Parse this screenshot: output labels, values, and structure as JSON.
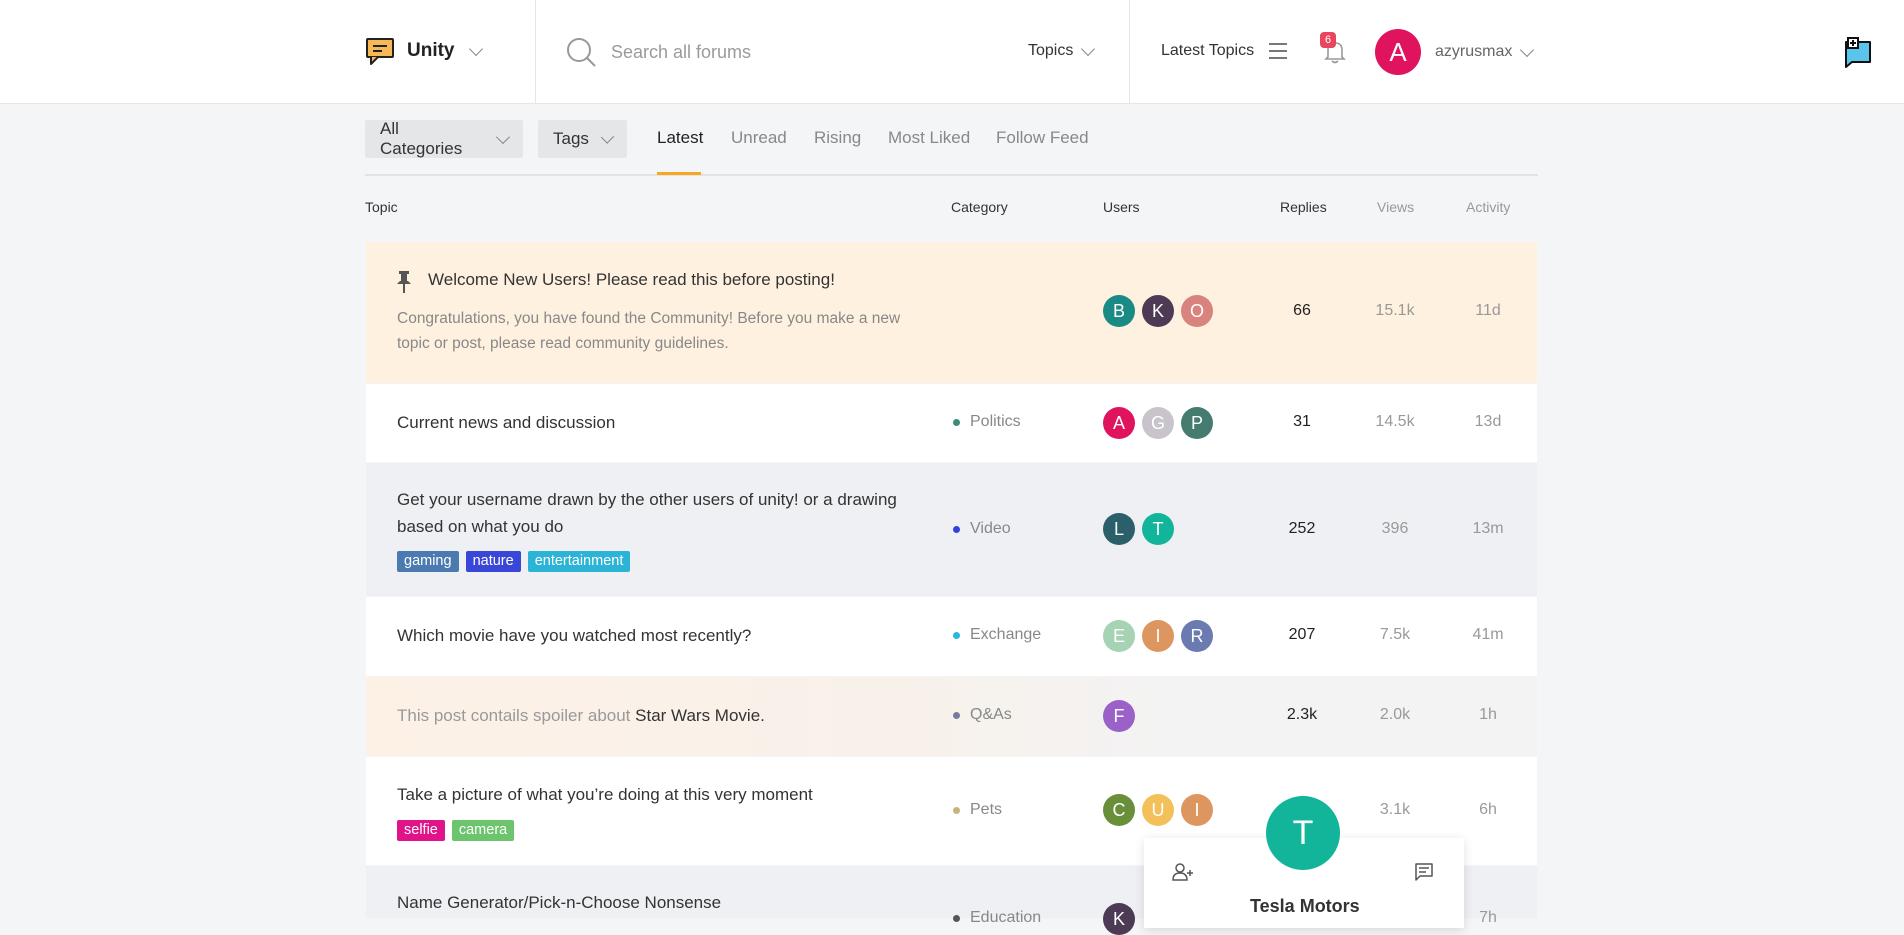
{
  "header": {
    "brand": "Unity",
    "search_placeholder": "Search all forums",
    "topics_label": "Topics",
    "latest_topics_label": "Latest Topics",
    "notification_count": "6",
    "user_initial": "A",
    "username": "azyrusmax"
  },
  "filters": {
    "categories_label": "All Categories",
    "tags_label": "Tags",
    "tabs": [
      "Latest",
      "Unread",
      "Rising",
      "Most Liked",
      "Follow Feed"
    ],
    "active_tab": "Latest"
  },
  "columns": {
    "topic": "Topic",
    "category": "Category",
    "users": "Users",
    "replies": "Replies",
    "views": "Views",
    "activity": "Activity"
  },
  "topics": [
    {
      "title": "Welcome New Users! Please read this before posting!",
      "excerpt_line1": "Congratulations, you have found the Community! Before you make a new",
      "excerpt_line2": "topic or post, please read community guidelines.",
      "pinned": true,
      "users": [
        {
          "i": "B",
          "color": "#1a8a85"
        },
        {
          "i": "K",
          "color": "#4d3a55"
        },
        {
          "i": "O",
          "color": "#d9837e"
        }
      ],
      "replies": "66",
      "views": "15.1k",
      "activity": "11d"
    },
    {
      "title": "Current news and discussion",
      "category": "Politics",
      "category_color": "#3a8b7a",
      "users": [
        {
          "i": "A",
          "color": "#e0135f"
        },
        {
          "i": "G",
          "color": "#c9c4cc"
        },
        {
          "i": "P",
          "color": "#467b70"
        }
      ],
      "replies": "31",
      "views": "14.5k",
      "activity": "13d"
    },
    {
      "title_line1": "Get your username drawn by the other users of unity! or a drawing",
      "title_line2": "based on what you do",
      "category": "Video",
      "category_color": "#3340e0",
      "tags": [
        {
          "name": "gaming",
          "color": "#4a7ab0"
        },
        {
          "name": "nature",
          "color": "#3a46d8"
        },
        {
          "name": "entertainment",
          "color": "#2bb4d6"
        }
      ],
      "users": [
        {
          "i": "L",
          "color": "#2b5f6a"
        },
        {
          "i": "T",
          "color": "#12b59a"
        }
      ],
      "replies": "252",
      "views": "396",
      "activity": "13m"
    },
    {
      "title": "Which movie have you watched most recently?",
      "category": "Exchange",
      "category_color": "#2bb4e6",
      "users": [
        {
          "i": "E",
          "color": "#a6d3b4"
        },
        {
          "i": "I",
          "color": "#de9660"
        },
        {
          "i": "R",
          "color": "#6b7ab0"
        }
      ],
      "replies": "207",
      "views": "7.5k",
      "activity": "41m"
    },
    {
      "spoiler_prefix": "This post contails spoiler about",
      "spoiler_subject": "Star Wars Movie.",
      "category": "Q&As",
      "category_color": "#7a7aa0",
      "users": [
        {
          "i": "F",
          "color": "#9a62c8"
        }
      ],
      "replies": "2.3k",
      "views": "2.0k",
      "activity": "1h"
    },
    {
      "title": "Take a picture of what you’re doing at this very moment",
      "category": "Pets",
      "category_color": "#c9b37a",
      "tags": [
        {
          "name": "selfie",
          "color": "#e0138a"
        },
        {
          "name": "camera",
          "color": "#6cc46c"
        }
      ],
      "users": [
        {
          "i": "C",
          "color": "#6a8f3a"
        },
        {
          "i": "U",
          "color": "#f4c05a"
        },
        {
          "i": "I",
          "color": "#de9660"
        }
      ],
      "views": "3.1k",
      "activity": "6h"
    },
    {
      "title": "Name Generator/Pick-n-Choose Nonsense",
      "category": "Education",
      "category_color": "#555",
      "users": [
        {
          "i": "K",
          "color": "#4d3a55"
        }
      ],
      "activity": "7h"
    }
  ],
  "user_card": {
    "initial": "T",
    "name": "Tesla Motors"
  }
}
